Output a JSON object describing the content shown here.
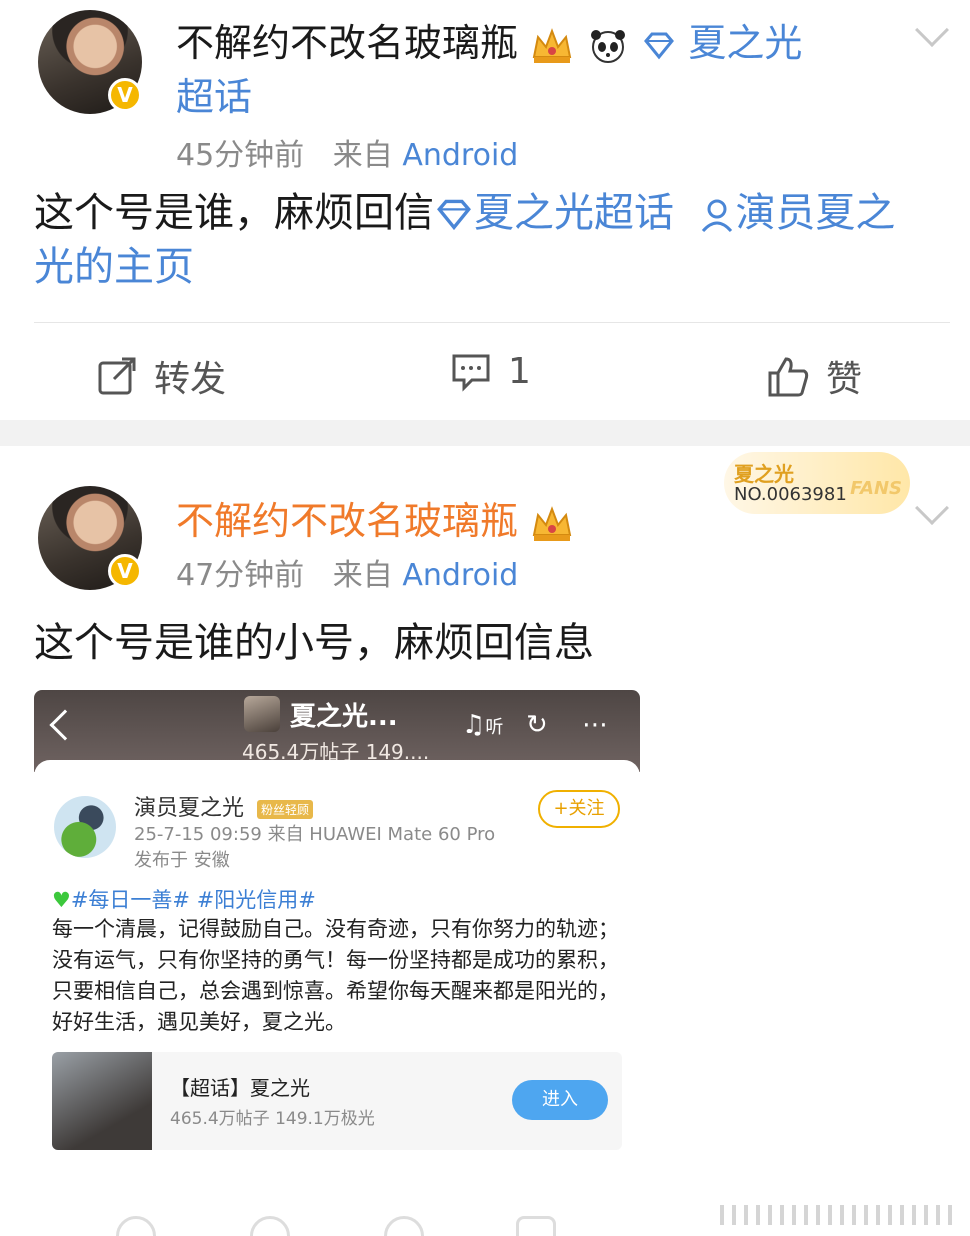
{
  "post1": {
    "username": "不解约不改名玻璃瓶",
    "crown_icon": "crown-icon",
    "panda_icon": "panda-icon",
    "topic_link": "夏之光",
    "topic_link_tail": "超话",
    "time": "45分钟前",
    "from_label": "来自",
    "source": "Android",
    "text_plain": "这个号是谁，麻烦回信",
    "text_link1": "夏之光超话",
    "text_link2_a": "演员夏之",
    "text_link2_b": "光的主页"
  },
  "actions": {
    "repost": "转发",
    "comment_count": "1",
    "like": "赞"
  },
  "post2": {
    "username": "不解约不改名玻璃瓶",
    "time": "47分钟前",
    "from_label": "来自",
    "source": "Android",
    "text": "这个号是谁的小号，麻烦回信息",
    "fans_card": {
      "name": "夏之光",
      "number": "NO.0063981",
      "fans_label": "FANS"
    }
  },
  "embedded": {
    "header_title": "夏之光...",
    "header_sub": "465.4万帖子 149....",
    "header_listen": "听",
    "author": "演员夏之光",
    "author_badge": "粉丝轻顾",
    "follow": "+关注",
    "meta": "25-7-15 09:59  来自 HUAWEI Mate 60 Pro",
    "location": "发布于 安徽",
    "tags": "#每日一善#   #阳光信用#",
    "content": "每一个清晨，记得鼓励自己。没有奇迹，只有你努力的轨迹；没有运气，只有你坚持的勇气！每一份坚持都是成功的累积，只要相信自己，总会遇到惊喜。希望你每天醒来都是阳光的，好好生活，遇见美好，夏之光。",
    "topic_title": "【超话】夏之光",
    "topic_stats": "465.4万帖子 149.1万极光",
    "enter": "进入"
  },
  "colors": {
    "link": "#4a86d6",
    "vip_name": "#f07a2a",
    "verified": "#f5b700"
  }
}
